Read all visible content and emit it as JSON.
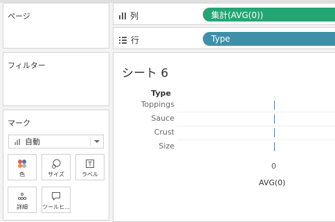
{
  "panels": {
    "pages": "ページ",
    "filters": "フィルター",
    "marks": {
      "title": "マーク",
      "mark_type": "自動",
      "buttons": [
        "色",
        "サイズ",
        "ラベル",
        "詳細",
        "ツールヒ..."
      ]
    }
  },
  "shelves": {
    "columns": {
      "label": "列",
      "pill": "集計(AVG(0))",
      "pill_color": "#23a574"
    },
    "rows": {
      "label": "行",
      "pill": "Type",
      "pill_color": "#3e8fa8"
    }
  },
  "sheet": {
    "title": "シート 6",
    "row_header": "Type"
  },
  "chart_data": {
    "type": "bar",
    "categories": [
      "Toppings",
      "Sauce",
      "Crust",
      "Size"
    ],
    "values": [
      0,
      0,
      0,
      0
    ],
    "xlabel": "AVG(0)",
    "ylabel": "Type",
    "x_ticks": [
      "0"
    ],
    "mark_color": "#4e79a7"
  }
}
